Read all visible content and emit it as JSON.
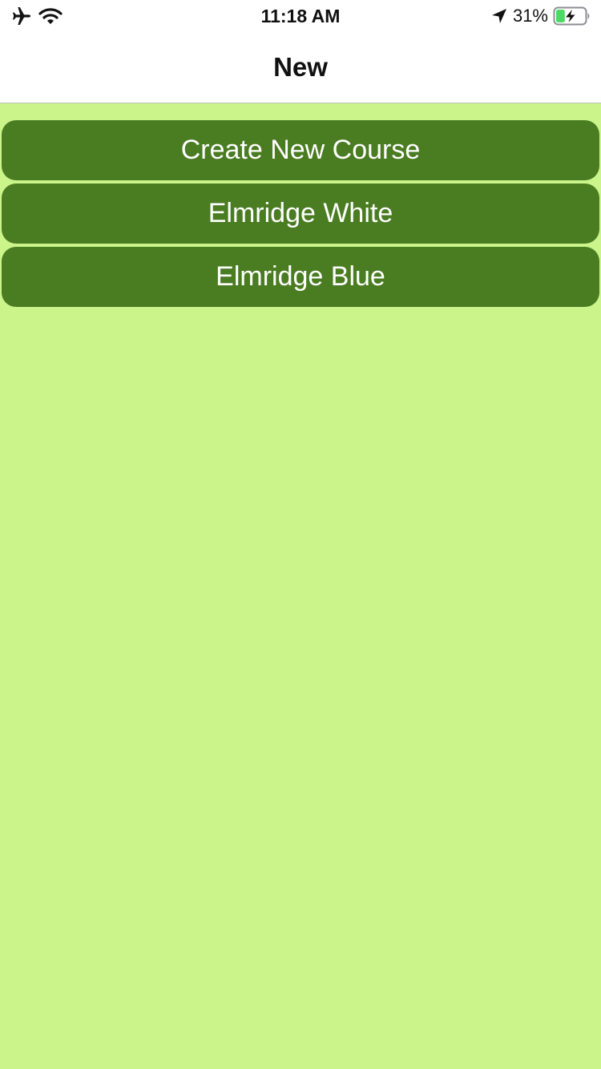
{
  "status_bar": {
    "time": "11:18 AM",
    "battery_percent": "31%",
    "battery_level": 0.31,
    "battery_charging": true,
    "icons": [
      "airplane-icon",
      "wifi-icon",
      "location-arrow-icon",
      "battery-icon"
    ]
  },
  "nav": {
    "title": "New"
  },
  "courses": {
    "create_label": "Create New Course",
    "items": [
      {
        "label": "Elmridge White"
      },
      {
        "label": "Elmridge Blue"
      }
    ]
  },
  "colors": {
    "background": "#cbf58b",
    "button": "#4a7c22",
    "button_text": "#ffffff",
    "battery_fill": "#4cd964"
  }
}
